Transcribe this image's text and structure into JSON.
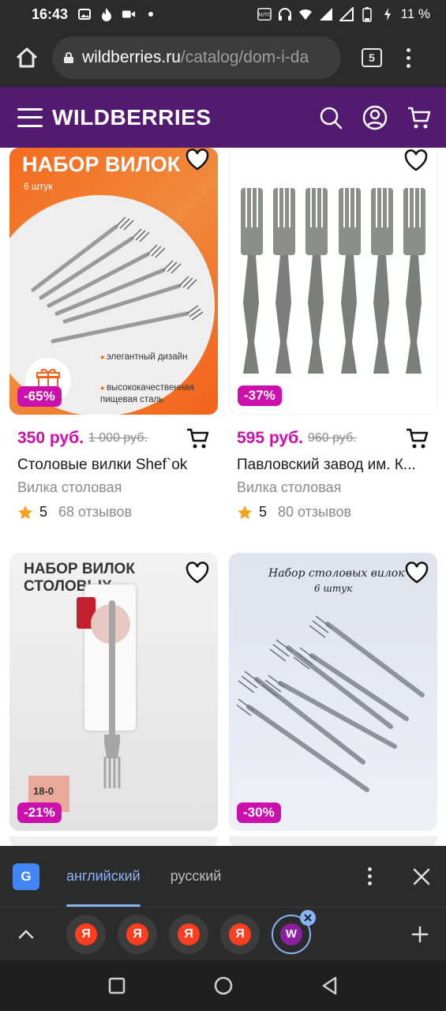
{
  "status_bar": {
    "time": "16:43",
    "battery": "11 %"
  },
  "browser": {
    "url_domain": "wildberries.ru",
    "url_path": "/catalog/dom-i-da",
    "tab_count": "5"
  },
  "site": {
    "logo": "WILDBERRIES",
    "brand_color": "#521b71",
    "accent_color": "#cb11ab"
  },
  "products": [
    {
      "image_title": "НАБОР ВИЛОК",
      "image_subtitle": "6 штук",
      "image_features": [
        "элегантный дизайн",
        "высококачественная пищевая сталь"
      ],
      "discount": "-65%",
      "price": "350 руб.",
      "old_price": "1 000 руб.",
      "name": "Столовые вилки Shef`ok",
      "category": "Вилка столовая",
      "rating": "5",
      "reviews": "68 отзывов"
    },
    {
      "discount": "-37%",
      "price": "595 руб.",
      "old_price": "960 руб.",
      "name": "Павловский завод им. К...",
      "category": "Вилка столовая",
      "rating": "5",
      "reviews": "80 отзывов"
    },
    {
      "image_title": "НАБОР ВИЛОК СТОЛОВЫХ",
      "image_steel": "18-0",
      "discount": "-21%"
    },
    {
      "image_title": "Набор столовых вилок",
      "image_subtitle": "6 штук",
      "discount": "-30%"
    }
  ],
  "translate_bar": {
    "lang_active": "английский",
    "lang_inactive": "русский"
  },
  "tab_strip": {
    "tabs": [
      "Я",
      "Я",
      "Я",
      "Я",
      "W"
    ]
  }
}
